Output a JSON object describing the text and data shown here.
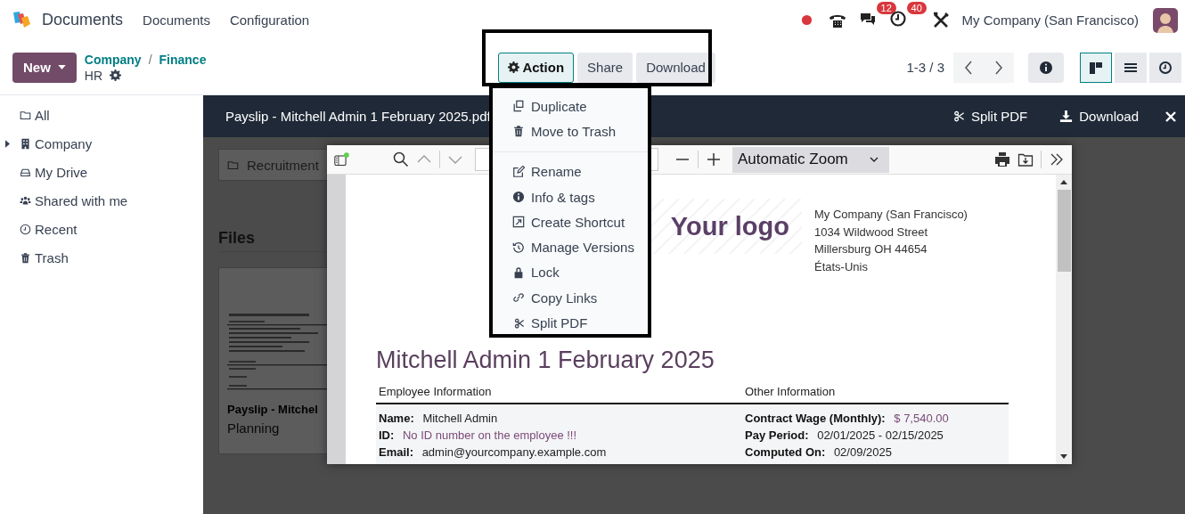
{
  "app": {
    "name": "Documents"
  },
  "menu": [
    "Documents",
    "Configuration"
  ],
  "systray": {
    "messages_badge": "12",
    "activities_badge": "40",
    "company": "My Company (San Francisco)"
  },
  "new_button": "New",
  "breadcrumbs": [
    "Company",
    "Finance"
  ],
  "breadcrumb_separator": "/",
  "current_folder": "HR",
  "actions": [
    {
      "label": "Action",
      "selected": true
    },
    {
      "label": "Share",
      "selected": false
    },
    {
      "label": "Download",
      "selected": false
    }
  ],
  "pager": "1-3 / 3",
  "views": [
    {
      "kind": "kanban",
      "selected": true
    },
    {
      "kind": "list",
      "selected": false
    },
    {
      "kind": "activity",
      "selected": false
    }
  ],
  "sidebar": [
    {
      "label": "All",
      "kind": "folder"
    },
    {
      "label": "Company",
      "kind": "building",
      "expanded": false
    },
    {
      "label": "My Drive",
      "kind": "drive"
    },
    {
      "label": "Shared with me",
      "kind": "users"
    },
    {
      "label": "Recent",
      "kind": "clock"
    },
    {
      "label": "Trash",
      "kind": "trash"
    }
  ],
  "action_menu": [
    [
      {
        "label": "Duplicate",
        "kind": "copy"
      },
      {
        "label": "Move to Trash",
        "kind": "trash"
      }
    ],
    [
      {
        "label": "Rename",
        "kind": "edit"
      },
      {
        "label": "Info & tags",
        "kind": "info"
      },
      {
        "label": "Create Shortcut",
        "kind": "shortcut"
      },
      {
        "label": "Manage Versions",
        "kind": "history"
      },
      {
        "label": "Lock",
        "kind": "lock"
      },
      {
        "label": "Copy Links",
        "kind": "link"
      },
      {
        "label": "Split PDF",
        "kind": "scissors"
      }
    ]
  ],
  "viewer": {
    "title": "Payslip - Mitchell Admin 1 February 2025.pdf",
    "buttons": [
      {
        "label": "Split PDF",
        "kind": "scissors"
      },
      {
        "label": "Download",
        "kind": "download"
      }
    ]
  },
  "folders": [
    "Recruitment"
  ],
  "files_heading": "Files",
  "file_card": {
    "title": "Payslip - Mitchel",
    "tag": "Planning"
  },
  "pdf": {
    "zoom": "Automatic Zoom",
    "logo": "Your logo",
    "address": [
      "My Company (San Francisco)",
      "1034 Wildwood Street",
      "Millersburg OH 44654",
      "États-Unis"
    ],
    "title": "Mitchell Admin 1 February 2025",
    "headings": [
      "Employee Information",
      "Other Information"
    ],
    "left_rows": [
      {
        "label": "Name:",
        "value": "Mitchell Admin",
        "highlight": false
      },
      {
        "label": "ID:",
        "value": "No ID number on the employee !!!",
        "highlight": true
      },
      {
        "label": "Email:",
        "value": "admin@yourcompany.example.com",
        "highlight": false
      }
    ],
    "right_rows": [
      {
        "label": "Contract Wage (Monthly):",
        "value": "$ 7,540.00",
        "highlight": true
      },
      {
        "label": "Pay Period:",
        "value": "02/01/2025 - 02/15/2025",
        "highlight": false
      },
      {
        "label": "Computed On:",
        "value": "02/09/2025",
        "highlight": false
      }
    ]
  }
}
